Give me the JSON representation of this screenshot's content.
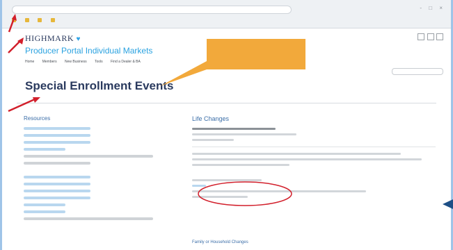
{
  "browser": {
    "url_placeholder": "",
    "window_controls": "- □ ×",
    "bookmarks": [
      "",
      "",
      "",
      ""
    ]
  },
  "header": {
    "logo_text": "HIGHMARK",
    "portal_title": "Producer Portal Individual Markets",
    "nav": [
      "Home",
      "Members",
      "New Business",
      "Tools",
      "Find a Dealer & BA"
    ]
  },
  "callout": {
    "text": "",
    "color": "#f2a93b"
  },
  "page": {
    "title": "Special Enrollment Events"
  },
  "left": {
    "resources_title": "Resources"
  },
  "right": {
    "life_title": "Life Changes",
    "family_title": "Family or Household Changes"
  },
  "colors": {
    "arrow": "#d21f2b",
    "accent": "#2aa2e0",
    "brand": "#2a3a5e"
  }
}
